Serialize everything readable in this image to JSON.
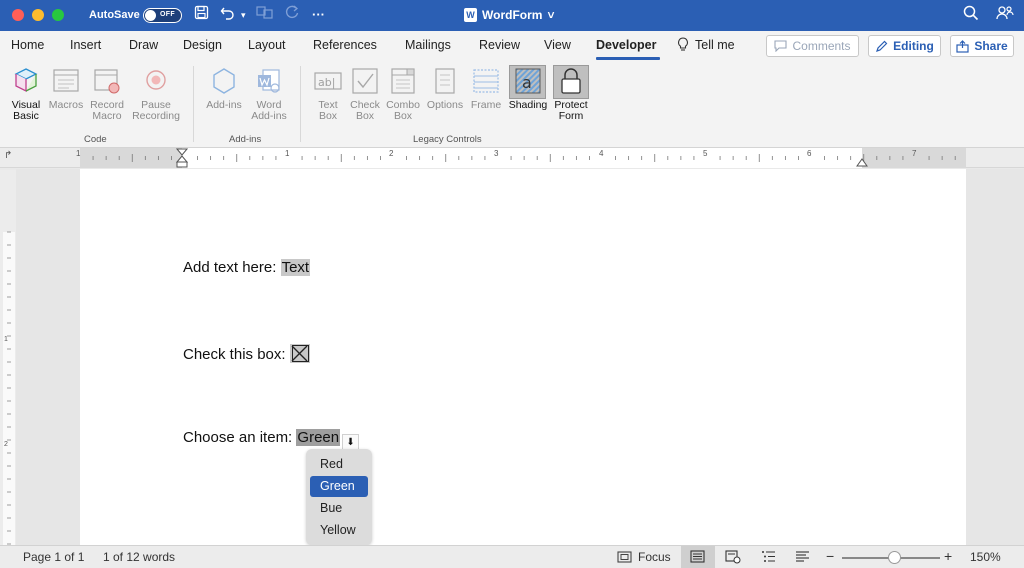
{
  "titlebar": {
    "autosave_label": "AutoSave",
    "autosave_state": "OFF",
    "more": "···",
    "doc_title": "WordForm",
    "doc_title_chevron": "˅",
    "word_logo": "W"
  },
  "tabs": {
    "items": [
      "Home",
      "Insert",
      "Draw",
      "Design",
      "Layout",
      "References",
      "Mailings",
      "Review",
      "View",
      "Developer"
    ],
    "active": "Developer",
    "tell_me": "Tell me"
  },
  "actions": {
    "comments": "Comments",
    "editing": "Editing",
    "share": "Share"
  },
  "ribbon": {
    "code": {
      "label": "Code",
      "visual_basic": [
        "Visual",
        "Basic"
      ],
      "macros": "Macros",
      "record_macro": [
        "Record",
        "Macro"
      ],
      "pause_recording": [
        "Pause",
        "Recording"
      ]
    },
    "addins": {
      "label": "Add-ins",
      "add_ins": "Add-ins",
      "word_add_ins": [
        "Word",
        "Add-ins"
      ]
    },
    "legacy": {
      "label": "Legacy Controls",
      "text_box": [
        "Text",
        "Box"
      ],
      "check_box": [
        "Check",
        "Box"
      ],
      "combo_box": [
        "Combo",
        "Box"
      ],
      "options": "Options",
      "frame": "Frame",
      "shading": "Shading",
      "protect_form": [
        "Protect",
        "Form"
      ]
    }
  },
  "ruler": {
    "numbers": [
      "1",
      "1",
      "2",
      "3",
      "4",
      "5",
      "6",
      "7"
    ],
    "v_numbers": [
      "1",
      "2"
    ]
  },
  "document": {
    "line1_label": "Add text here: ",
    "line1_field": "Text",
    "line2_label": "Check this box: ",
    "line3_label": "Choose an item: ",
    "line3_field": "Green",
    "dropdown_options": [
      "Red",
      "Green",
      "Bue",
      "Yellow"
    ],
    "dropdown_selected": "Green"
  },
  "status": {
    "page": "Page 1 of 1",
    "words": "1 of 12 words",
    "focus": "Focus",
    "zoom": "150%",
    "zoom_minus": "−",
    "zoom_plus": "+"
  },
  "colors": {
    "accent": "#2b5fb4",
    "titlebar": "#2b5fb4"
  }
}
